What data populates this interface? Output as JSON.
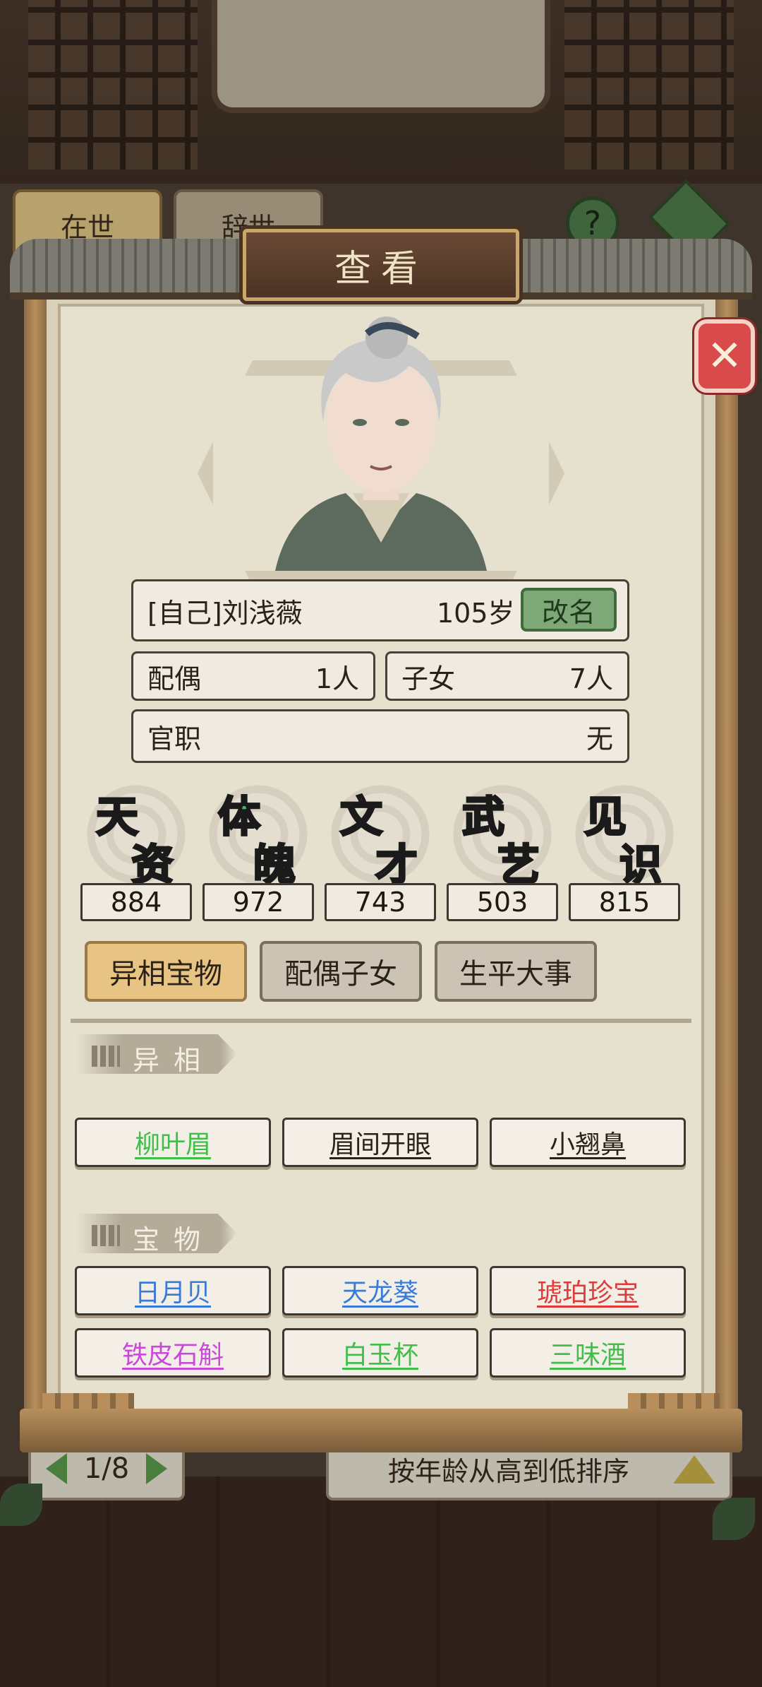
{
  "background": {
    "tabs": [
      "在世",
      "辞世"
    ],
    "help_label": "?",
    "pager": "1/8",
    "sort_label": "按年龄从高到低排序"
  },
  "dialog": {
    "title": "查看",
    "close_label": "✕"
  },
  "person": {
    "name": "[自己]刘浅薇",
    "age": "105岁",
    "rename_label": "改名",
    "spouse_label": "配偶",
    "spouse_value": "1人",
    "children_label": "子女",
    "children_value": "7人",
    "office_label": "官职",
    "office_value": "无"
  },
  "attributes": [
    {
      "name": "天资",
      "value": "884",
      "color": "#4a78e0"
    },
    {
      "name": "体魄",
      "value": "972",
      "color": "#3fb86a"
    },
    {
      "name": "文才",
      "value": "743",
      "color": "#b05ad0"
    },
    {
      "name": "武艺",
      "value": "503",
      "color": "#e0a030"
    },
    {
      "name": "见识",
      "value": "815",
      "color": "#e05050"
    }
  ],
  "tabs": [
    "异相宝物",
    "配偶子女",
    "生平大事"
  ],
  "active_tab": "异相宝物",
  "sections": {
    "traits_title": "异相",
    "treasures_title": "宝物"
  },
  "traits": [
    {
      "label": "柳叶眉",
      "color": "#3fbf4a"
    },
    {
      "label": "眉间开眼",
      "color": "#2a2218"
    },
    {
      "label": "小翘鼻",
      "color": "#2a2218"
    }
  ],
  "treasures": [
    {
      "label": "日月贝",
      "color": "#3a7ad8"
    },
    {
      "label": "天龙葵",
      "color": "#3a7ad8"
    },
    {
      "label": "琥珀珍宝",
      "color": "#e03a3a"
    },
    {
      "label": "铁皮石斛",
      "color": "#c84ad8"
    },
    {
      "label": "白玉杯",
      "color": "#3fbf4a"
    },
    {
      "label": "三味酒",
      "color": "#3fbf4a"
    }
  ]
}
